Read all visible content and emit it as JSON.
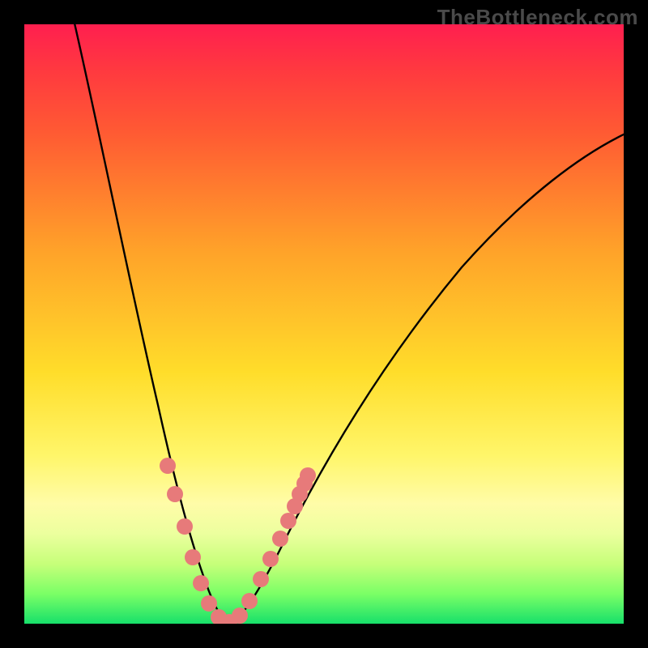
{
  "watermark": "TheBottleneck.com",
  "chart_data": {
    "type": "line",
    "title": "",
    "xlabel": "",
    "ylabel": "",
    "xlim": [
      0,
      100
    ],
    "ylim": [
      0,
      100
    ],
    "grid": false,
    "legend": false,
    "curve_left": {
      "description": "Left descending branch of the V-shaped bottleneck curve (bottleneck % vs relative component performance, left side of optimum).",
      "x": [
        5,
        10,
        15,
        20,
        22,
        24,
        26,
        28,
        30,
        32,
        33
      ],
      "y": [
        100,
        80,
        55,
        28,
        20,
        14,
        10,
        6,
        3,
        1,
        0
      ]
    },
    "curve_right": {
      "description": "Right ascending branch of the V-shaped bottleneck curve (bottleneck % vs relative component performance, right side of optimum).",
      "x": [
        33,
        35,
        38,
        42,
        48,
        55,
        65,
        80,
        100
      ],
      "y": [
        0,
        2,
        7,
        15,
        27,
        40,
        55,
        70,
        82
      ]
    },
    "highlight_points_left": {
      "description": "Emphasised sample points on the left branch near the trough.",
      "x": [
        22,
        24,
        26,
        28,
        30,
        32,
        33
      ],
      "y": [
        20,
        14,
        10,
        6,
        3,
        1,
        0
      ]
    },
    "highlight_points_right": {
      "description": "Emphasised sample points on the right branch near the trough.",
      "x": [
        34,
        35,
        37,
        39,
        41,
        42,
        43,
        44
      ],
      "y": [
        1,
        2,
        5,
        9,
        13,
        17,
        21,
        24
      ]
    },
    "gradient_meaning": "Vertical color gradient encodes bottleneck severity: red≈100% (top) through green≈0% (bottom).",
    "optimum_x_approx": 33,
    "optimum_y": 0
  }
}
